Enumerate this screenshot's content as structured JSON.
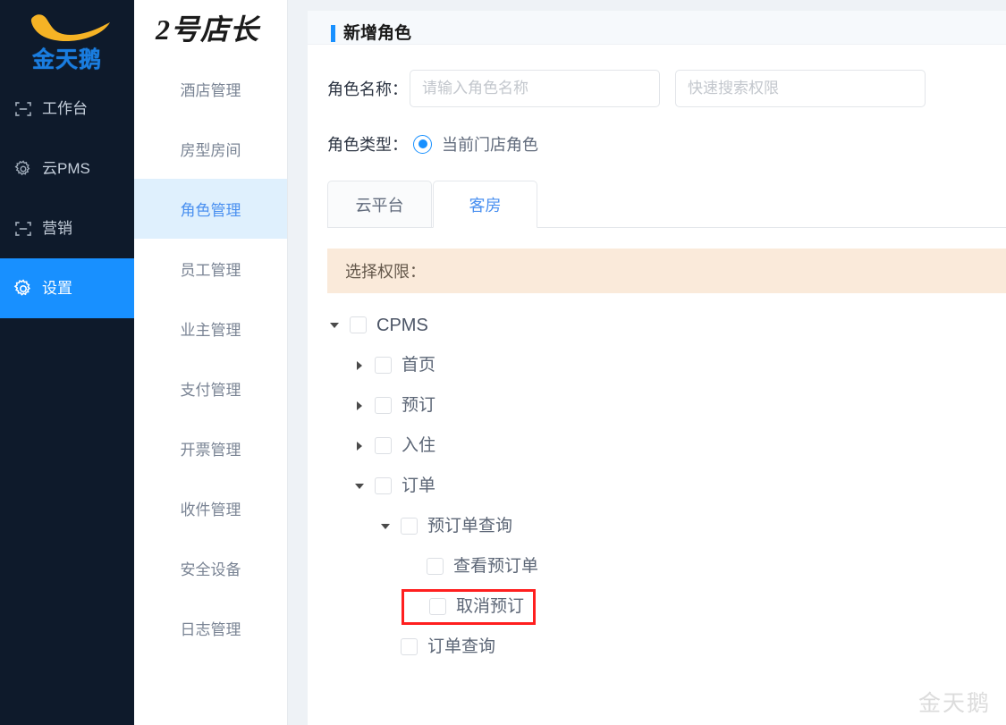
{
  "sidebar": {
    "logo": {
      "icon": "swan-swoosh-logo",
      "text": "金天鹅",
      "swoosh_color": "#f5b325",
      "text_color": "#1a7de0"
    },
    "items": [
      {
        "icon": "workbench-icon",
        "label": "工作台",
        "active": false
      },
      {
        "icon": "gear-icon",
        "label": "云PMS",
        "active": false
      },
      {
        "icon": "megaphone-icon",
        "label": "营销",
        "active": false
      },
      {
        "icon": "gear-icon",
        "label": "设置",
        "active": true
      }
    ],
    "active_color": "#1890ff",
    "background": "#0e1a2b"
  },
  "submenu": {
    "brand_title": "2号店长",
    "items": [
      {
        "label": "酒店管理",
        "active": false
      },
      {
        "label": "房型房间",
        "active": false
      },
      {
        "label": "角色管理",
        "active": true
      },
      {
        "label": "员工管理",
        "active": false
      },
      {
        "label": "业主管理",
        "active": false
      },
      {
        "label": "支付管理",
        "active": false
      },
      {
        "label": "开票管理",
        "active": false
      },
      {
        "label": "收件管理",
        "active": false
      },
      {
        "label": "安全设备",
        "active": false
      },
      {
        "label": "日志管理",
        "active": false
      }
    ],
    "active_bg": "#dff0fd",
    "active_color": "#4a90f0"
  },
  "main": {
    "card_title": "新增角色",
    "form": {
      "role_name_label": "角色名称：",
      "role_name_value": "",
      "role_name_placeholder": "请输入角色名称",
      "search_value": "",
      "search_placeholder": "快速搜索权限",
      "role_type_label": "角色类型：",
      "role_type_options": [
        {
          "label": "当前门店角色",
          "selected": true
        }
      ]
    },
    "tabs": [
      {
        "label": "云平台",
        "active": false
      },
      {
        "label": "客房",
        "active": true
      }
    ],
    "permission_bar_label": "选择权限：",
    "tree": [
      {
        "label": "CPMS",
        "depth": 0,
        "arrow": "down",
        "checked": false,
        "latin": true,
        "highlight": false
      },
      {
        "label": "首页",
        "depth": 1,
        "arrow": "right",
        "checked": false,
        "latin": false,
        "highlight": false
      },
      {
        "label": "预订",
        "depth": 1,
        "arrow": "right",
        "checked": false,
        "latin": false,
        "highlight": false
      },
      {
        "label": "入住",
        "depth": 1,
        "arrow": "right",
        "checked": false,
        "latin": false,
        "highlight": false
      },
      {
        "label": "订单",
        "depth": 1,
        "arrow": "down",
        "checked": false,
        "latin": false,
        "highlight": false
      },
      {
        "label": "预订单查询",
        "depth": 2,
        "arrow": "down",
        "checked": false,
        "latin": false,
        "highlight": false
      },
      {
        "label": "查看预订单",
        "depth": 3,
        "arrow": "none",
        "checked": false,
        "latin": false,
        "highlight": false
      },
      {
        "label": "取消预订",
        "depth": 3,
        "arrow": "none",
        "checked": false,
        "latin": false,
        "highlight": true
      },
      {
        "label": "订单查询",
        "depth": 2,
        "arrow": "none",
        "checked": false,
        "latin": false,
        "highlight": false
      }
    ],
    "highlight_color": "#ff1f1f",
    "watermark": "金天鹅"
  }
}
